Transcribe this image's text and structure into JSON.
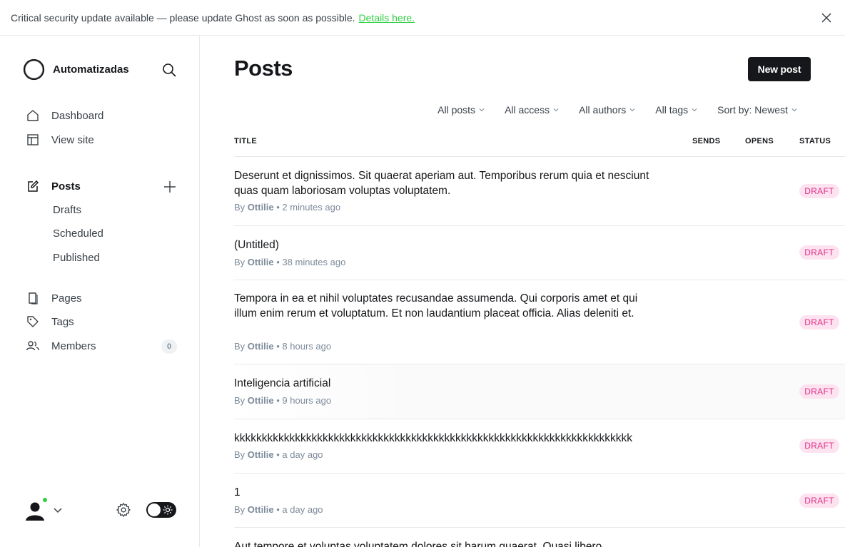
{
  "banner": {
    "text": "Critical security update available — please update Ghost as soon as possible.",
    "link": "Details here."
  },
  "sidebar": {
    "brand": "Automatizadas",
    "nav": {
      "dashboard": "Dashboard",
      "view_site": "View site",
      "posts": "Posts",
      "drafts": "Drafts",
      "scheduled": "Scheduled",
      "published": "Published",
      "pages": "Pages",
      "tags": "Tags",
      "members": "Members",
      "members_count": "0"
    }
  },
  "main": {
    "title": "Posts",
    "new_post": "New post",
    "filters": [
      "All posts",
      "All access",
      "All authors",
      "All tags",
      "Sort by: Newest"
    ],
    "columns": {
      "title": "TITLE",
      "sends": "SENDS",
      "opens": "OPENS",
      "status": "STATUS"
    },
    "posts": [
      {
        "title": "Deserunt et dignissimos. Sit quaerat aperiam aut. Temporibus rerum quia et nesciunt quas quam laboriosam voluptas voluptatem.",
        "by": "By",
        "author": "Ottilie",
        "time": "• 2 minutes ago",
        "status": "DRAFT"
      },
      {
        "title": "(Untitled)",
        "by": "By",
        "author": "Ottilie",
        "time": "• 38 minutes ago",
        "status": "DRAFT"
      },
      {
        "title": "Tempora in ea et nihil voluptates recusandae assumenda. Qui corporis amet et qui illum enim rerum et voluptatum. Et non laudantium placeat officia. Alias deleniti et.",
        "by": "By",
        "author": "Ottilie",
        "time": "• 8 hours ago",
        "status": "DRAFT"
      },
      {
        "title": "Inteligencia artificial",
        "by": "By",
        "author": "Ottilie",
        "time": "• 9 hours ago",
        "status": "DRAFT"
      },
      {
        "title": "kkkkkkkkkkkkkkkkkkkkkkkkkkkkkkkkkkkkkkkkkkkkkkkkkkkkkkkkkkkkkkkkkkkkkkkk",
        "by": "By",
        "author": "Ottilie",
        "time": "• a day ago",
        "status": "DRAFT"
      },
      {
        "title": "1",
        "by": "By",
        "author": "Ottilie",
        "time": "• a day ago",
        "status": "DRAFT"
      },
      {
        "title": "Aut tempore et voluptas voluptatem dolores sit harum quaerat. Quasi libero",
        "by": "",
        "author": "",
        "time": "",
        "status": ""
      }
    ]
  },
  "colors": {
    "accent_green": "#30cf43",
    "draft_bg": "#fde2ef",
    "draft_text": "#e22e8a",
    "button_dark": "#15171a"
  }
}
